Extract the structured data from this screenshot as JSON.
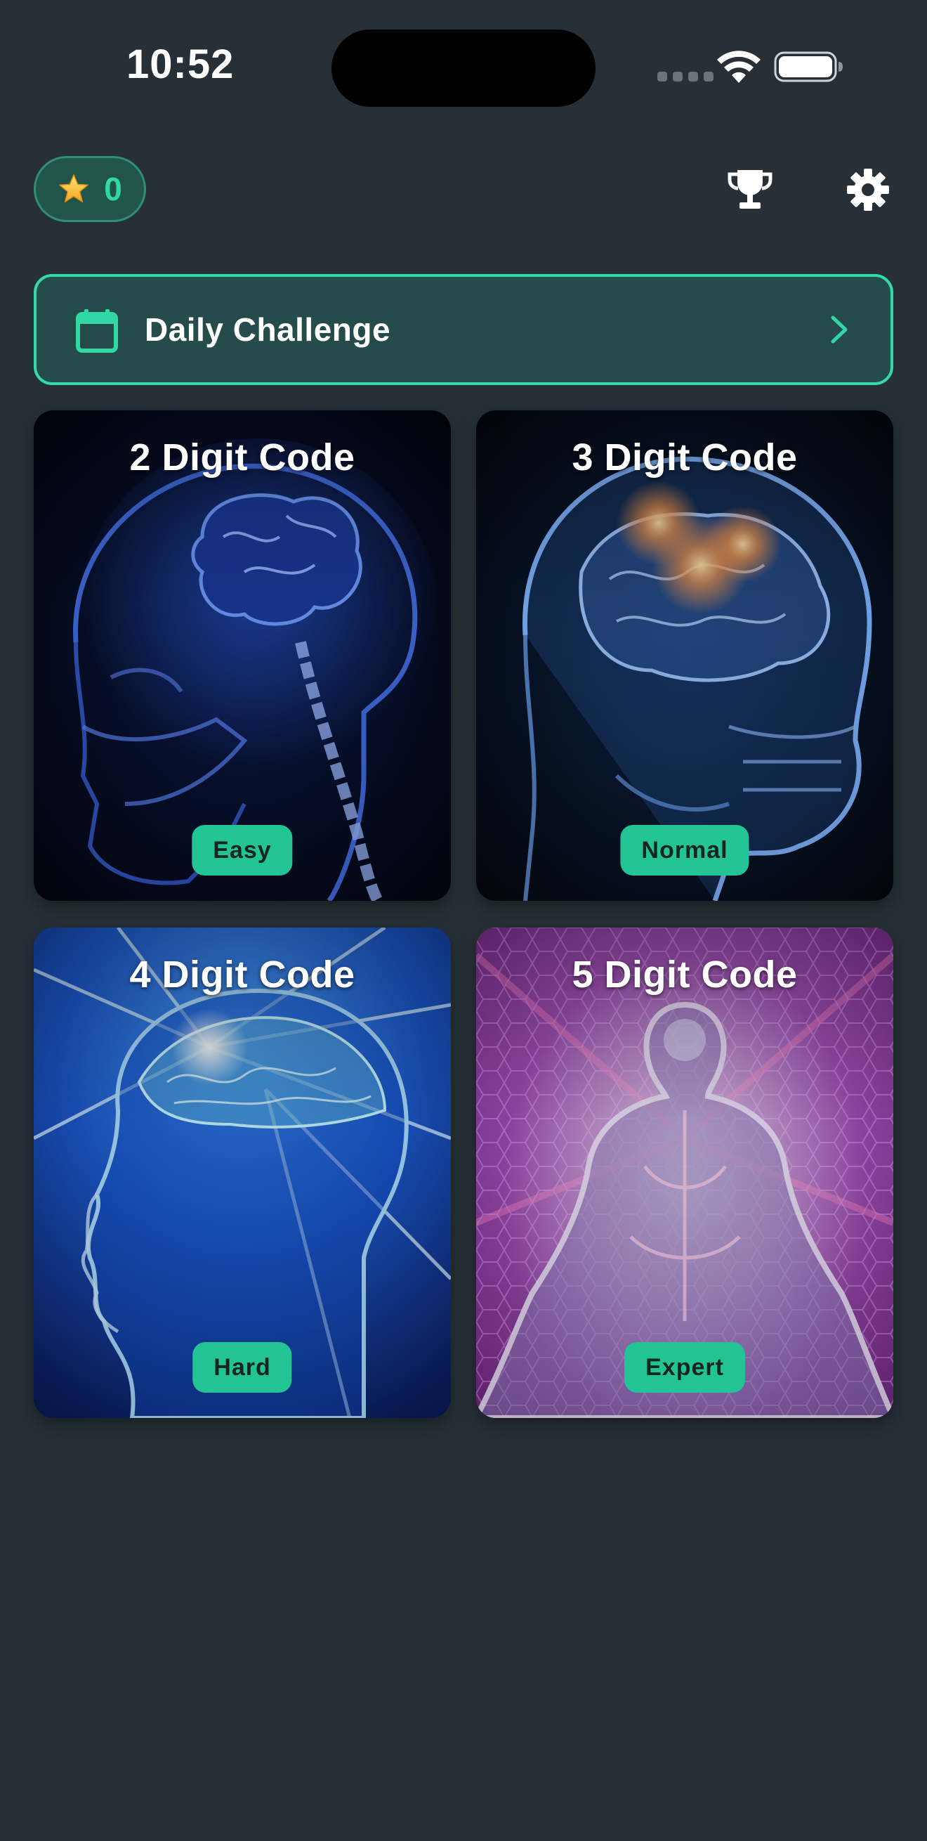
{
  "status_bar": {
    "time": "10:52",
    "icons": [
      "signal-dots",
      "wifi-icon",
      "battery-icon"
    ]
  },
  "header": {
    "star_count": "0",
    "star_icon": "star-icon",
    "actions": [
      "trophy-icon",
      "gear-icon"
    ]
  },
  "daily_challenge": {
    "label": "Daily Challenge",
    "icon": "calendar-icon"
  },
  "levels": [
    {
      "title": "2 Digit Code",
      "difficulty": "Easy",
      "art": "blue-xray-skull-brain"
    },
    {
      "title": "3 Digit Code",
      "difficulty": "Normal",
      "art": "glowing-brain-skull"
    },
    {
      "title": "4 Digit Code",
      "difficulty": "Hard",
      "art": "radiant-blue-head"
    },
    {
      "title": "5 Digit Code",
      "difficulty": "Expert",
      "art": "psychedelic-figure"
    }
  ],
  "colors": {
    "background": "#263036",
    "accent": "#33d9a8",
    "badge": "#22c495",
    "daily_fill": "#254b4a"
  }
}
